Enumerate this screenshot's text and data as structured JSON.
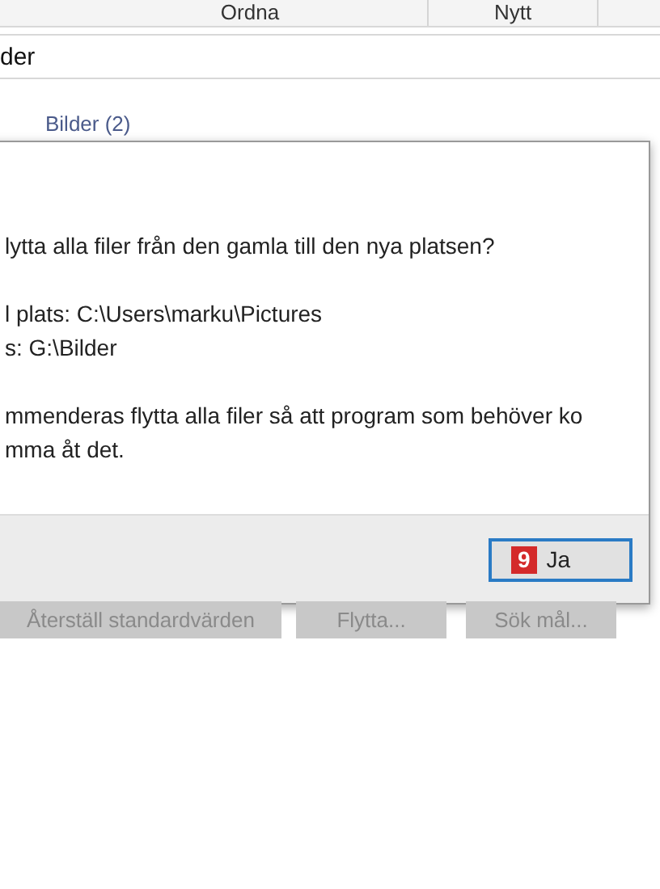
{
  "tabs": [
    {
      "label": "Ordna"
    },
    {
      "label": "Nytt"
    }
  ],
  "path_field": {
    "value": "der"
  },
  "folder_link": "Bilder (2)",
  "dialog": {
    "lines": [
      {
        "kind": "text",
        "text": "lytta alla filer från den gamla till den nya platsen?"
      },
      {
        "kind": "gap"
      },
      {
        "kind": "text",
        "text": "l plats: C:\\Users\\marku\\Pictures"
      },
      {
        "kind": "text",
        "text": "s: G:\\Bilder"
      },
      {
        "kind": "gap"
      },
      {
        "kind": "text",
        "text": "mmenderas flytta alla filer så att program som behöver ko"
      },
      {
        "kind": "text",
        "text": "mma åt det."
      }
    ],
    "badge": "9",
    "button": "Ja"
  },
  "bottom_buttons": [
    "Återställ standardvärden",
    "Flytta...",
    "Sök mål..."
  ]
}
